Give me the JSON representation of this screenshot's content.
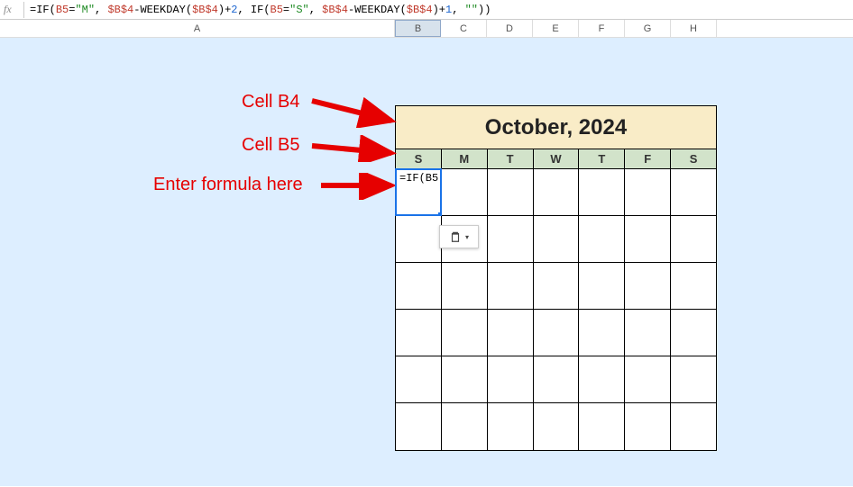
{
  "formula_bar": {
    "fx_label": "fx",
    "formula_tokens": [
      {
        "cls": "t-op",
        "t": "="
      },
      {
        "cls": "t-fn",
        "t": "IF"
      },
      {
        "cls": "t-op",
        "t": "("
      },
      {
        "cls": "t-ref",
        "t": "B5"
      },
      {
        "cls": "t-op",
        "t": "="
      },
      {
        "cls": "t-str",
        "t": "\"M\""
      },
      {
        "cls": "t-op",
        "t": ", "
      },
      {
        "cls": "t-ref",
        "t": "$B$4"
      },
      {
        "cls": "t-op",
        "t": "-"
      },
      {
        "cls": "t-fn",
        "t": "WEEKDAY"
      },
      {
        "cls": "t-op",
        "t": "("
      },
      {
        "cls": "t-ref",
        "t": "$B$4"
      },
      {
        "cls": "t-op",
        "t": ")+"
      },
      {
        "cls": "t-num",
        "t": "2"
      },
      {
        "cls": "t-op",
        "t": ", "
      },
      {
        "cls": "t-fn",
        "t": "IF"
      },
      {
        "cls": "t-op",
        "t": "("
      },
      {
        "cls": "t-ref",
        "t": "B5"
      },
      {
        "cls": "t-op",
        "t": "="
      },
      {
        "cls": "t-str",
        "t": "\"S\""
      },
      {
        "cls": "t-op",
        "t": ", "
      },
      {
        "cls": "t-ref",
        "t": "$B$4"
      },
      {
        "cls": "t-op",
        "t": "-"
      },
      {
        "cls": "t-fn",
        "t": "WEEKDAY"
      },
      {
        "cls": "t-op",
        "t": "("
      },
      {
        "cls": "t-ref",
        "t": "$B$4"
      },
      {
        "cls": "t-op",
        "t": ")+"
      },
      {
        "cls": "t-num",
        "t": "1"
      },
      {
        "cls": "t-op",
        "t": ", "
      },
      {
        "cls": "t-str",
        "t": "\"\""
      },
      {
        "cls": "t-op",
        "t": "))"
      }
    ]
  },
  "columns": [
    "A",
    "B",
    "C",
    "D",
    "E",
    "F",
    "G",
    "H"
  ],
  "calendar": {
    "title": "October, 2024",
    "days": [
      "S",
      "M",
      "T",
      "W",
      "T",
      "F",
      "S"
    ],
    "rows": 6
  },
  "active_cell": {
    "display": "=IF(B5"
  },
  "annotations": {
    "a1": "Cell B4",
    "a2": "Cell B5",
    "a3": "Enter formula here"
  },
  "colors": {
    "annotation": "#e60000",
    "selection": "#1a73e8",
    "sheet_bg": "#dbeafc",
    "cal_title_bg": "#f9ecc7",
    "cal_day_bg": "#d2e3ca"
  }
}
